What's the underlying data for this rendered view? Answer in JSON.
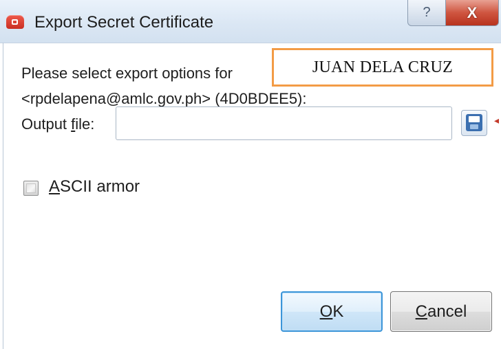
{
  "window": {
    "title": "Export Secret Certificate",
    "help_label": "?",
    "close_label": "X"
  },
  "prompt": {
    "line1": "Please select export options for",
    "line2": "<rpdelapena@amlc.gov.ph> (4D0BDEE5):"
  },
  "redaction_name": "JUAN DELA CRUZ",
  "output_file": {
    "label_prefix": "Output ",
    "label_mnemonic": "f",
    "label_suffix": "ile:",
    "value": "",
    "save_icon": "floppy-disk-icon"
  },
  "ascii_armor": {
    "mnemonic": "A",
    "label_rest": "SCII armor",
    "checked": false
  },
  "buttons": {
    "ok_mnemonic": "O",
    "ok_rest": "K",
    "cancel_mnemonic": "C",
    "cancel_rest": "ancel"
  },
  "colors": {
    "annotation_border": "#f39b45",
    "default_button_border": "#3c95d8",
    "close_button": "#cf5540"
  }
}
